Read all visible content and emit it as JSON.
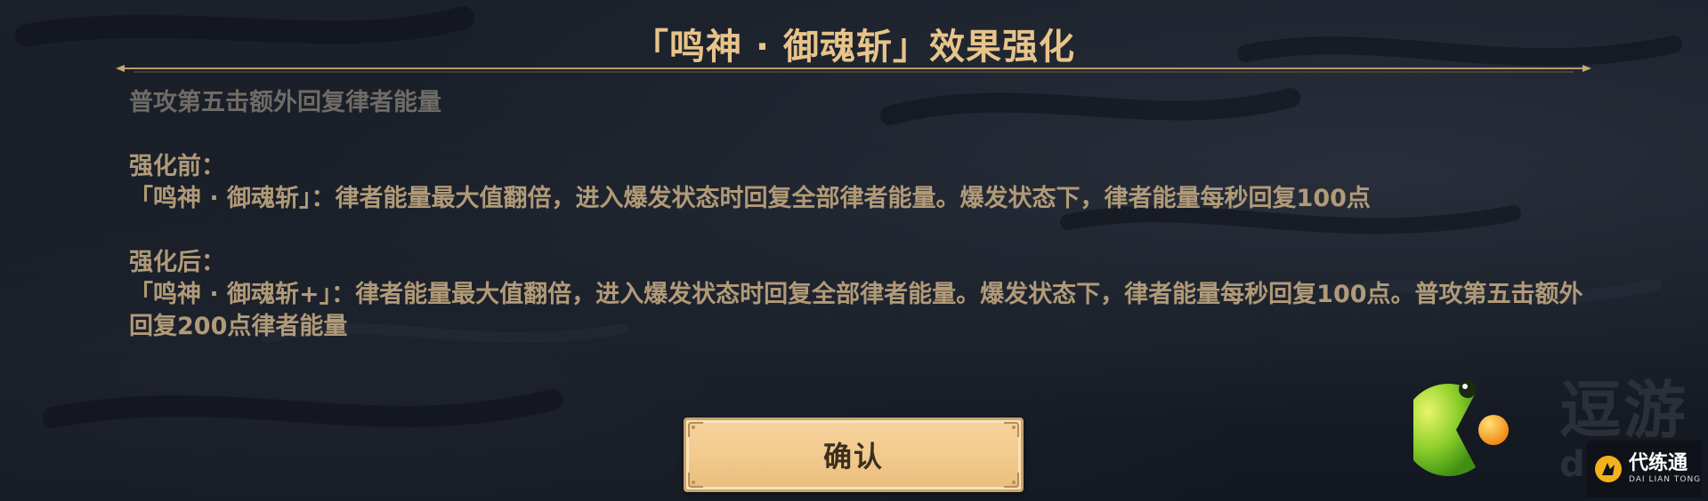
{
  "dialog": {
    "title": "「鸣神 · 御魂斩」效果强化",
    "summary": "普攻第五击额外回复律者能量",
    "before_label": "强化前：",
    "before_text": "「鸣神 · 御魂斩」：律者能量最大值翻倍，进入爆发状态时回复全部律者能量。爆发状态下，律者能量每秒回复100点",
    "after_label": "强化后：",
    "after_text": "「鸣神 · 御魂斩+」：律者能量最大值翻倍，进入爆发状态时回复全部律者能量。爆发状态下，律者能量每秒回复100点。普攻第五击额外回复200点律者能量",
    "confirm_label": "确认"
  },
  "watermark": {
    "text": "逗游",
    "sub": "d",
    "badge_title": "代练通",
    "badge_sub": "DAI LIAN TONG"
  },
  "colors": {
    "title": "#e8c48a",
    "body_text": "#b19a78",
    "summary_text": "#6f6b66",
    "button_fill": "#f2c98c",
    "background": "#161b24"
  }
}
